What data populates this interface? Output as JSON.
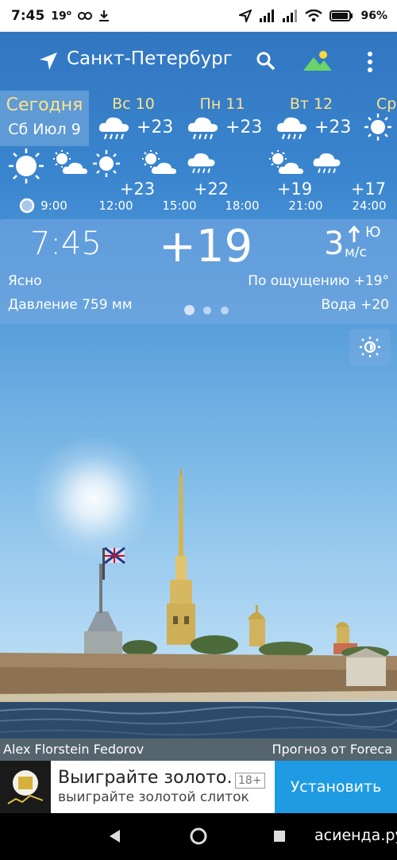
{
  "status": {
    "time": "7:45",
    "temp_indicator": "19",
    "battery": "96%"
  },
  "appbar": {
    "city": "Санкт-Петербург"
  },
  "days": [
    {
      "label": "Сегодня",
      "sublabel": "Сб Июл 9",
      "temp": ""
    },
    {
      "label": "Вс 10",
      "temp": "+23",
      "icon": "rain-cloud-icon"
    },
    {
      "label": "Пн 11",
      "temp": "+23",
      "icon": "rain-cloud-icon"
    },
    {
      "label": "Вт 12",
      "temp": "+23",
      "icon": "rain-cloud-icon"
    },
    {
      "label": "Ср",
      "temp": "",
      "icon": "sun-icon"
    }
  ],
  "hourly": {
    "temps": [
      "+23",
      "+22",
      "+19",
      "+17"
    ],
    "times": [
      "9:00",
      "12:00",
      "15:00",
      "18:00",
      "21:00",
      "24:00"
    ]
  },
  "current": {
    "time": "7:45",
    "temp": "+19",
    "wind_speed": "3",
    "wind_dir": "Ю",
    "wind_unit": "м/с",
    "condition": "Ясно",
    "feels_like": "По ощущению +19°",
    "pressure": "Давление 759 мм",
    "water": "Вода +20"
  },
  "credits": {
    "photo_author": "Alex Florstein Fedorov",
    "forecast_source": "Прогноз от Foreca"
  },
  "ad": {
    "title": "Выиграйте золото…",
    "age": "18+",
    "subtitle": "выиграйте золотой слиток",
    "install": "Установить"
  },
  "watermark": "асиенда.ру",
  "colors": {
    "accent_yellow": "#ffe38a",
    "ad_button": "#1e9be3"
  }
}
